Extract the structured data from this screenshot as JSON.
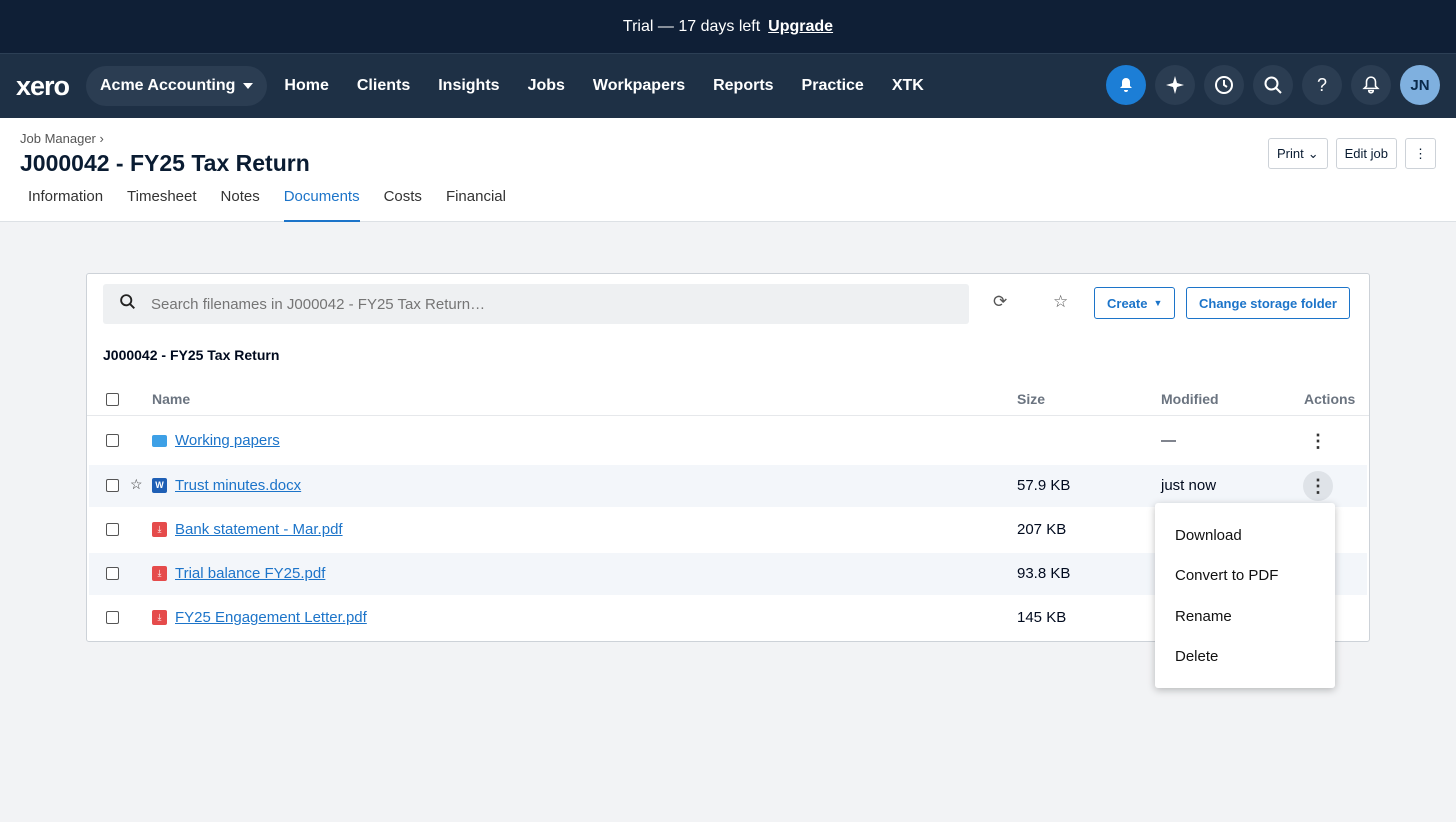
{
  "trial": {
    "text": "Trial — 17 days left",
    "upgrade": "Upgrade"
  },
  "nav": {
    "logo": "xero",
    "org": "Acme Accounting",
    "links": [
      "Home",
      "Clients",
      "Insights",
      "Jobs",
      "Workpapers",
      "Reports",
      "Practice",
      "XTK"
    ],
    "avatar": "JN",
    "icons": [
      "notification-bell-icon",
      "sparkle-icon",
      "clock-icon",
      "search-icon",
      "help-icon",
      "bell-icon"
    ]
  },
  "header": {
    "breadcrumb": "Job Manager",
    "title": "J000042 - FY25 Tax Return",
    "tabs": [
      "Information",
      "Timesheet",
      "Notes",
      "Documents",
      "Costs",
      "Financial"
    ],
    "active_tab": "Documents",
    "print": "Print",
    "edit": "Edit job"
  },
  "docs": {
    "search_placeholder": "Search filenames in J000042 - FY25 Tax Return…",
    "create": "Create",
    "change_folder": "Change storage folder",
    "folder_title": "J000042 - FY25 Tax Return",
    "columns": {
      "name": "Name",
      "size": "Size",
      "modified": "Modified",
      "actions": "Actions"
    },
    "rows": [
      {
        "name": "Working papers",
        "type": "folder",
        "size": "",
        "modified": "—"
      },
      {
        "name": "Trust minutes.docx",
        "type": "word",
        "size": "57.9 KB",
        "modified": "just now"
      },
      {
        "name": "Bank statement - Mar.pdf",
        "type": "pdf",
        "size": "207 KB",
        "modified": ""
      },
      {
        "name": "Trial balance FY25.pdf",
        "type": "pdf",
        "size": "93.8 KB",
        "modified": ""
      },
      {
        "name": "FY25 Engagement Letter.pdf",
        "type": "pdf",
        "size": "145 KB",
        "modified": ""
      }
    ]
  },
  "menu": {
    "items": [
      "Download",
      "Convert to PDF",
      "Rename",
      "Delete"
    ]
  }
}
